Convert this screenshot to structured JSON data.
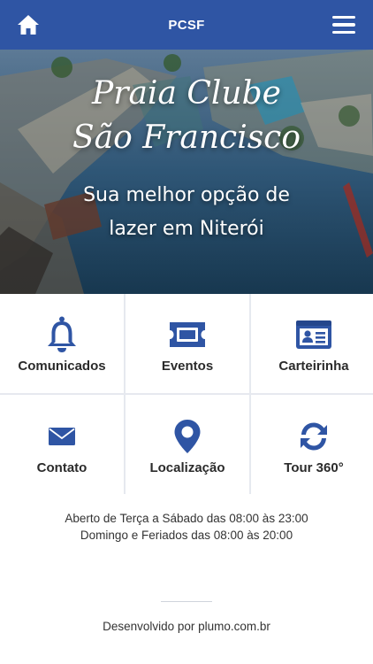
{
  "header": {
    "title": "PCSF",
    "home_icon": "home-icon",
    "menu_icon": "hamburger-menu-icon",
    "bar_color": "#2f55a4"
  },
  "hero": {
    "title_line1": "Praia Clube",
    "title_line2": "São Francisco",
    "subtitle_line1": "Sua melhor opção de",
    "subtitle_line2": "lazer em Niterói"
  },
  "menu": {
    "accent_color": "#2f55a4",
    "items": [
      {
        "label": "Comunicados",
        "icon": "bell-icon"
      },
      {
        "label": "Eventos",
        "icon": "ticket-icon"
      },
      {
        "label": "Carteirinha",
        "icon": "id-card-icon"
      },
      {
        "label": "Contato",
        "icon": "envelope-icon"
      },
      {
        "label": "Localização",
        "icon": "map-pin-icon"
      },
      {
        "label": "Tour 360°",
        "icon": "rotate-arrows-icon"
      }
    ]
  },
  "hours": {
    "line1": "Aberto de Terça a Sábado das 08:00 às 23:00",
    "line2": "Domingo e Feriados das 08:00 às 20:00"
  },
  "footer": {
    "credit": "Desenvolvido por plumo.com.br"
  }
}
